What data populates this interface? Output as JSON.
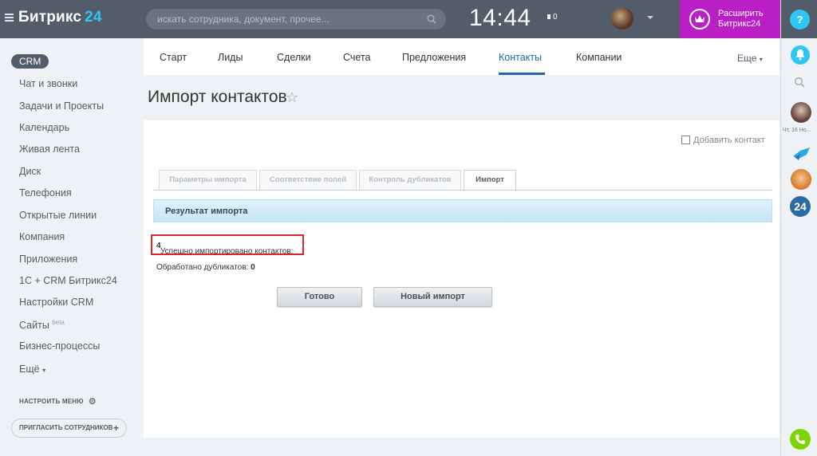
{
  "header": {
    "logo_text": "Битрикс",
    "logo_num": "24",
    "search_placeholder": "искать сотрудника, документ, прочее...",
    "time": "14:44",
    "flag_count": "0",
    "expand_line1": "Расширить",
    "expand_line2": "Битрикс24"
  },
  "rightbar": {
    "help": "?",
    "date_label": "Чт, 16 Но...",
    "badge_24": "24"
  },
  "leftmenu": {
    "crm": "CRM",
    "items": [
      "Чат и звонки",
      "Задачи и Проекты",
      "Календарь",
      "Живая лента",
      "Диск",
      "Телефония",
      "Открытые линии",
      "Компания",
      "Приложения",
      "1С + CRM Битрикс24",
      "Настройки CRM",
      "Сайты",
      "Бизнес-процессы"
    ],
    "sites_sup": "beta",
    "more": "Ещё",
    "configure": "НАСТРОИТЬ МЕНЮ",
    "invite": "ПРИГЛАСИТЬ СОТРУДНИКОВ"
  },
  "topnav": {
    "tabs": [
      "Старт",
      "Лиды",
      "Сделки",
      "Счета",
      "Предложения",
      "Контакты",
      "Компании"
    ],
    "active": "Контакты",
    "more": "Еще"
  },
  "page": {
    "title": "Импорт контактов",
    "add_contact": "Добавить контакт"
  },
  "import": {
    "tabs": [
      "Параметры импорта",
      "Соответствие полей",
      "Контроль дубликатов",
      "Импорт"
    ],
    "active_tab": "Импорт",
    "result_title": "Результат импорта",
    "success_label": "Успешно импортировано контактов:",
    "success_count": "4",
    "duplicates_label": "Обработано дубликатов:",
    "duplicates_count": "0",
    "done_button": "Готово",
    "new_import_button": "Новый импорт"
  },
  "colors": {
    "header_bg": "#535c69",
    "accent_blue": "#2fc6f6",
    "active_link": "#2067b0",
    "expand_purple": "#ba1fc6",
    "highlight_red": "#e0262a",
    "phone_green": "#7bd500"
  }
}
